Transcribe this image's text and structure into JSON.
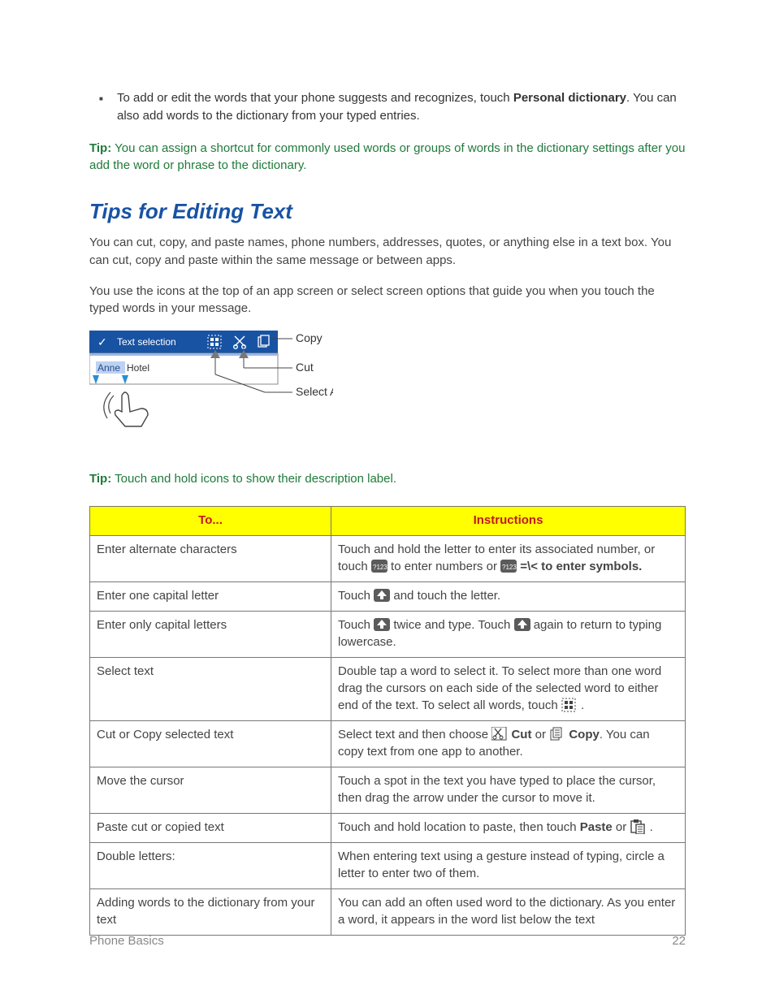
{
  "bullet1_pre": "To add or edit the words that your phone suggests and recognizes, touch ",
  "bullet1_bold": "Personal dictionary",
  "bullet1_post": ". You can also add words to the dictionary from your typed entries.",
  "tip1_label": "Tip:",
  "tip1_text": " You can assign a shortcut for commonly used words or groups of words in the dictionary settings after you add the word or phrase to the dictionary.",
  "heading": "Tips for Editing Text",
  "para1": "You can cut, copy, and paste names, phone numbers, addresses, quotes, or anything else in a text box. You can cut, copy and paste within the same message or between apps.",
  "para2": "You use the icons at the top of an app screen or select screen options that guide you when you touch the typed words in your message.",
  "diagram": {
    "toolbar_label": "Text selection",
    "sel_word": "Anne",
    "plain_word": " Hotel",
    "copy": "Copy",
    "cut": "Cut",
    "selectall": "Select All"
  },
  "tip2_label": "Tip:",
  "tip2_text": " Touch and hold icons to show their description label.",
  "table": {
    "h1": "To...",
    "h2": "Instructions",
    "rows": [
      {
        "to": "Enter alternate characters",
        "ins_a": "Touch and hold the letter to enter its associated number, or touch ",
        "ins_b": " to enter numbers or ",
        "ins_c": " =\\< to enter symbols."
      },
      {
        "to": "Enter one capital letter",
        "ins_a": "Touch ",
        "ins_b": " and touch the letter."
      },
      {
        "to": "Enter only capital letters",
        "ins_a": "Touch ",
        "ins_b": " twice and type. Touch ",
        "ins_c": " again to return to typing lowercase."
      },
      {
        "to": "Select text",
        "ins_a": "Double tap a word to select it. To select more than one word drag the cursors on each side of the selected word to either end of the text. To select all words, touch ",
        "ins_b": " ."
      },
      {
        "to": "Cut or Copy selected text",
        "ins_a": "Select text and then choose ",
        "cut": " Cut",
        "mid": " or ",
        "copy": " Copy",
        "ins_b": ". You can copy text from one app to another."
      },
      {
        "to": "Move the cursor",
        "ins": "Touch a spot in the text you have typed to place the cursor, then drag the arrow under the cursor to move it."
      },
      {
        "to": "Paste cut or copied text",
        "ins_a": "Touch and hold location to paste, then touch ",
        "paste": "Paste",
        "ins_b": " or ",
        "ins_c": " ."
      },
      {
        "to": "Double letters:",
        "ins": "When entering text using a gesture instead of typing, circle a letter to enter two of them."
      },
      {
        "to": "Adding words to the dictionary from your text",
        "ins": "You can add an often used word to the dictionary. As you enter a word, it appears in the word list below the text"
      }
    ]
  },
  "footer": {
    "section": "Phone Basics",
    "page": "22"
  },
  "icon_labels": {
    "q123": "?123"
  }
}
